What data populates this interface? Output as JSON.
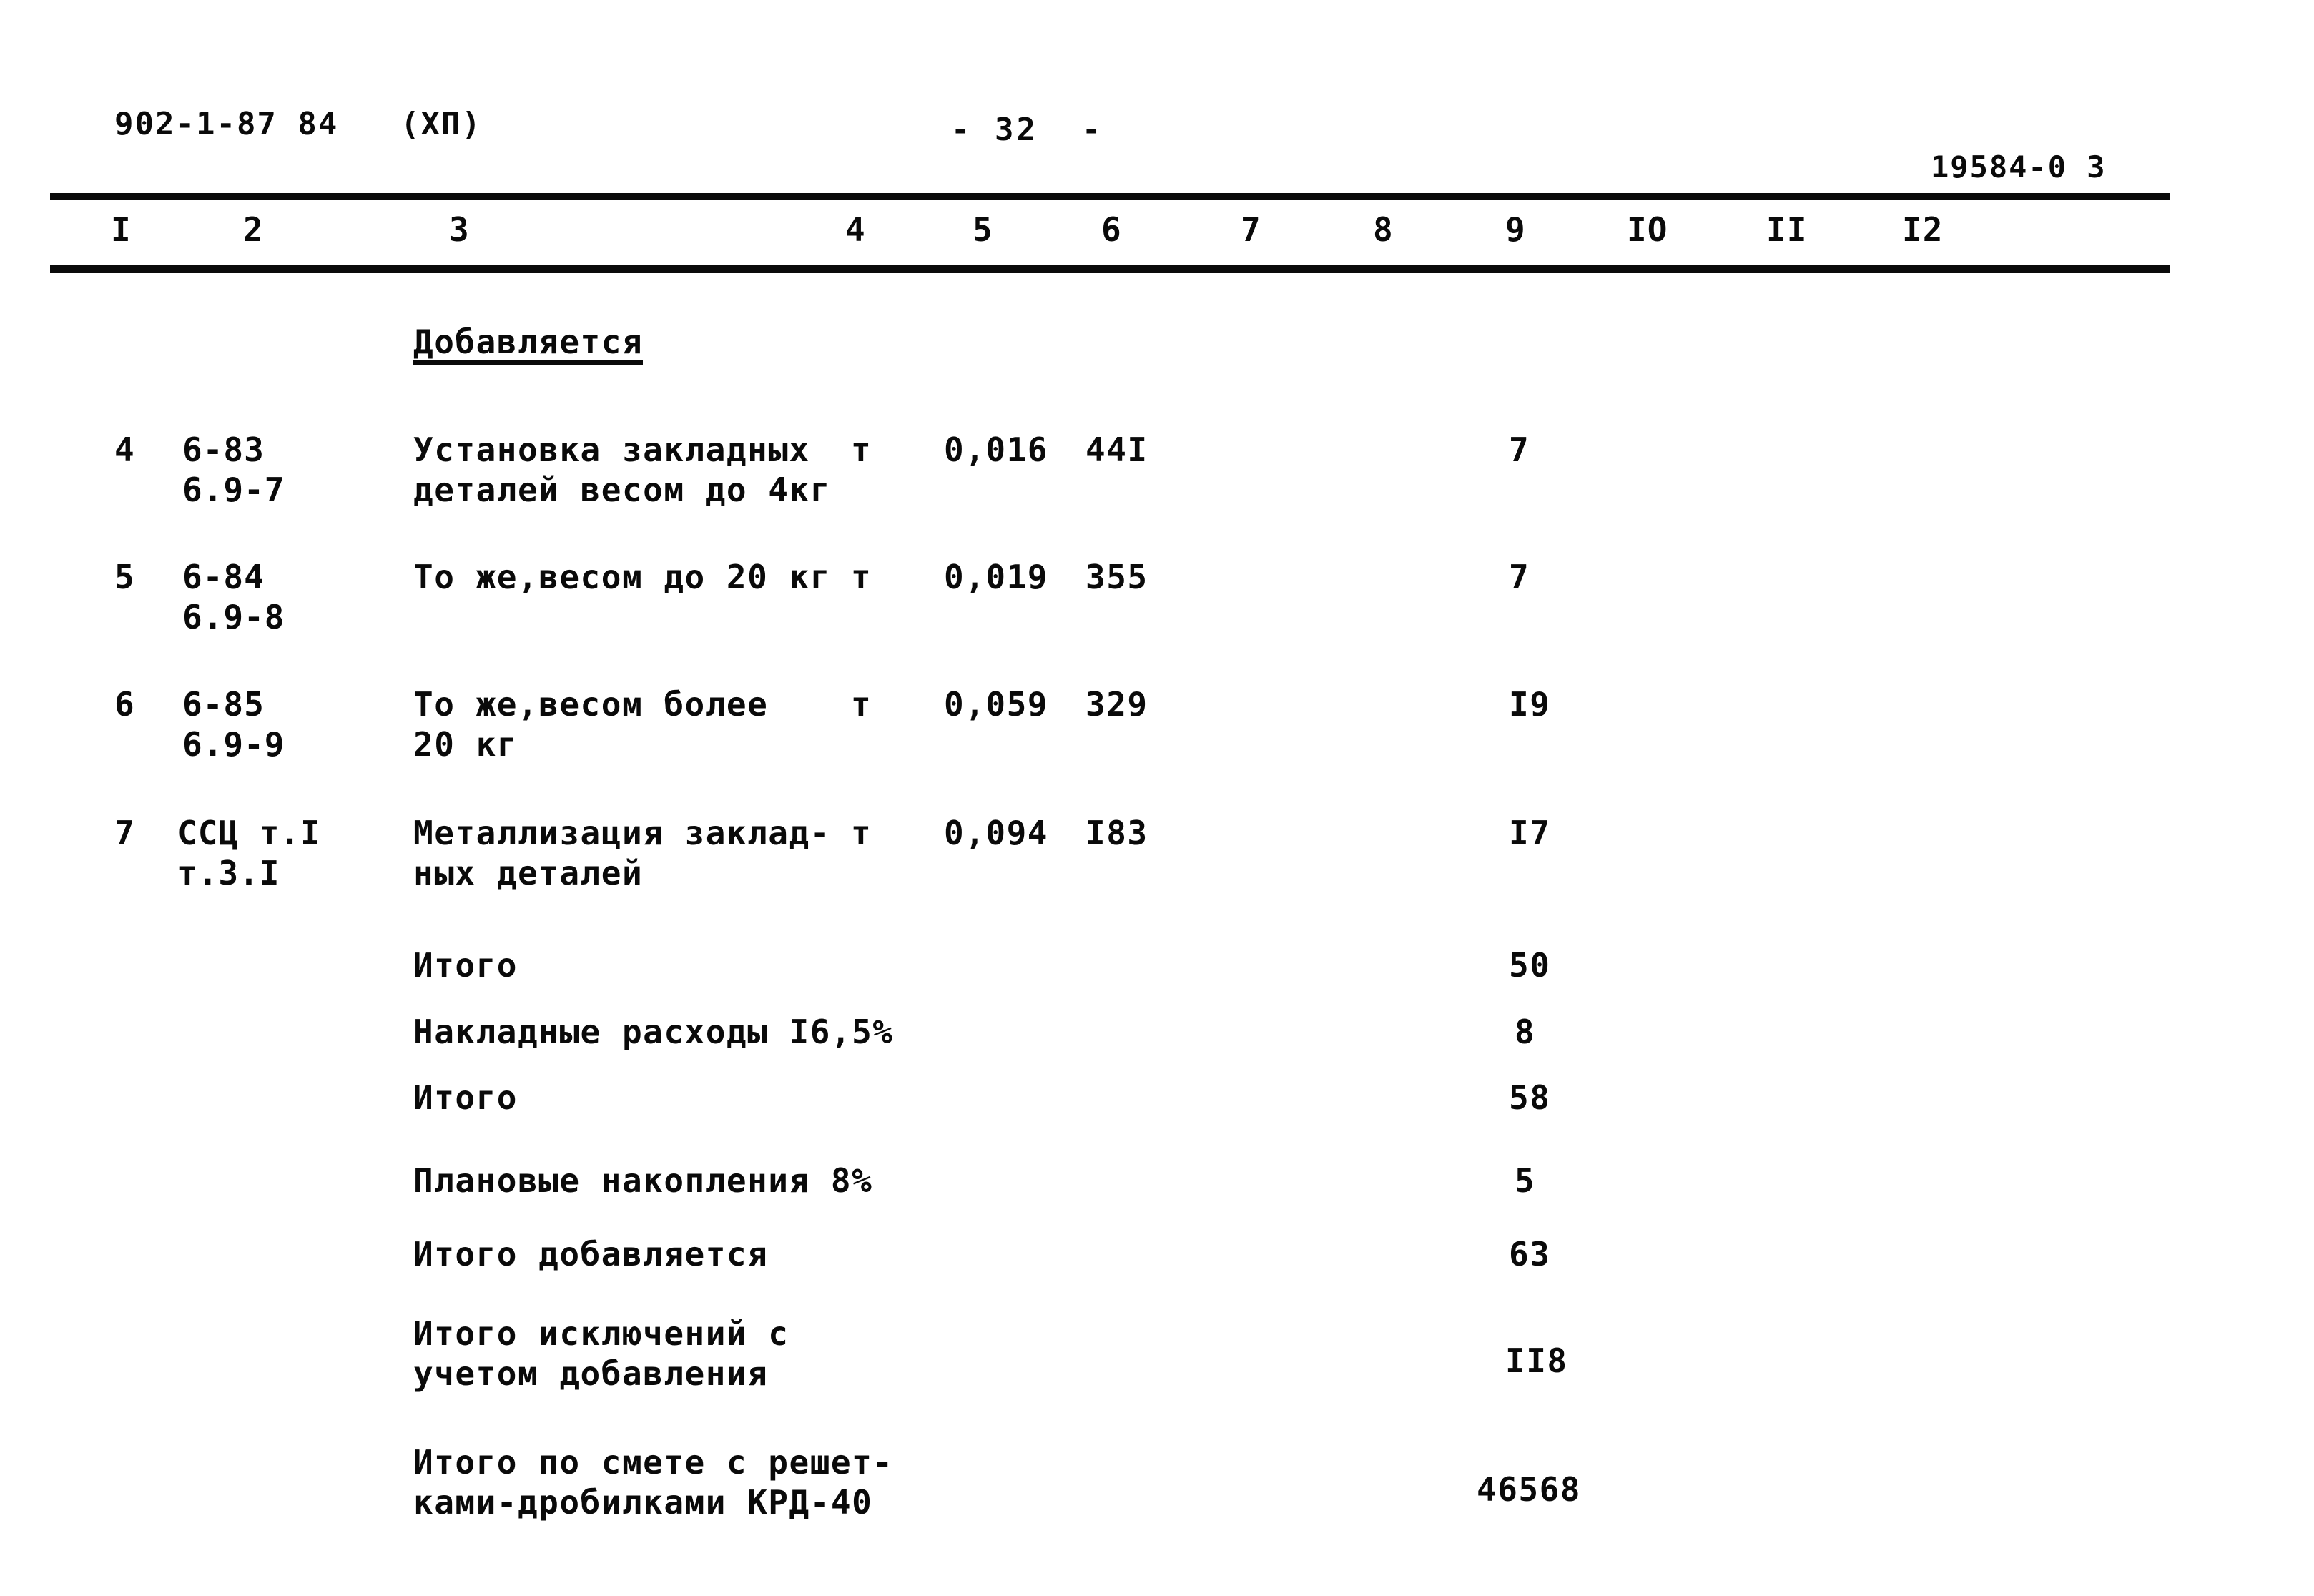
{
  "header": {
    "doc_code": "902-1-87 84",
    "doc_part": "(ХП)",
    "page_number": "- 32  -",
    "sheet_code": "19584-0 3"
  },
  "table": {
    "column_headers": [
      "I",
      "2",
      "3",
      "4",
      "5",
      "6",
      "7",
      "8",
      "9",
      "IO",
      "II",
      "I2"
    ],
    "section_title": "Добавляется",
    "rows": [
      {
        "num": "4",
        "code_line1": "6-83",
        "code_line2": "6.9-7",
        "desc_line1": "Установка закладных",
        "desc_line2": "деталей весом до 4кг",
        "unit": "т",
        "col5": "0,016",
        "col6": "44I",
        "col9": "7"
      },
      {
        "num": "5",
        "code_line1": "6-84",
        "code_line2": "6.9-8",
        "desc_line1": "То же,весом до 20 кг",
        "desc_line2": "",
        "unit": "т",
        "col5": "0,019",
        "col6": "355",
        "col9": "7"
      },
      {
        "num": "6",
        "code_line1": "6-85",
        "code_line2": "6.9-9",
        "desc_line1": "То же,весом более",
        "desc_line2": "20 кг",
        "unit": "т",
        "col5": "0,059",
        "col6": "329",
        "col9": "I9"
      },
      {
        "num": "7",
        "code_line1": "ССЦ т.I",
        "code_line2": "т.3.I",
        "desc_line1": "Металлизация заклад-",
        "desc_line2": "ных деталей",
        "unit": "т",
        "col5": "0,094",
        "col6": "I83",
        "col9": "I7"
      }
    ],
    "summary": [
      {
        "label_line1": "Итого",
        "label_line2": "",
        "value": "50"
      },
      {
        "label_line1": "Накладные расходы I6,5%",
        "label_line2": "",
        "value": "8"
      },
      {
        "label_line1": "Итого",
        "label_line2": "",
        "value": "58"
      },
      {
        "label_line1": "Плановые накопления 8%",
        "label_line2": "",
        "value": "5"
      },
      {
        "label_line1": "Итого добавляется",
        "label_line2": "",
        "value": "63"
      },
      {
        "label_line1": "Итого исключений с",
        "label_line2": "учетом добавления",
        "value": "II8"
      },
      {
        "label_line1": "Итого по смете с решет-",
        "label_line2": "ками-дробилками КРД-40",
        "value": "46568"
      }
    ]
  }
}
